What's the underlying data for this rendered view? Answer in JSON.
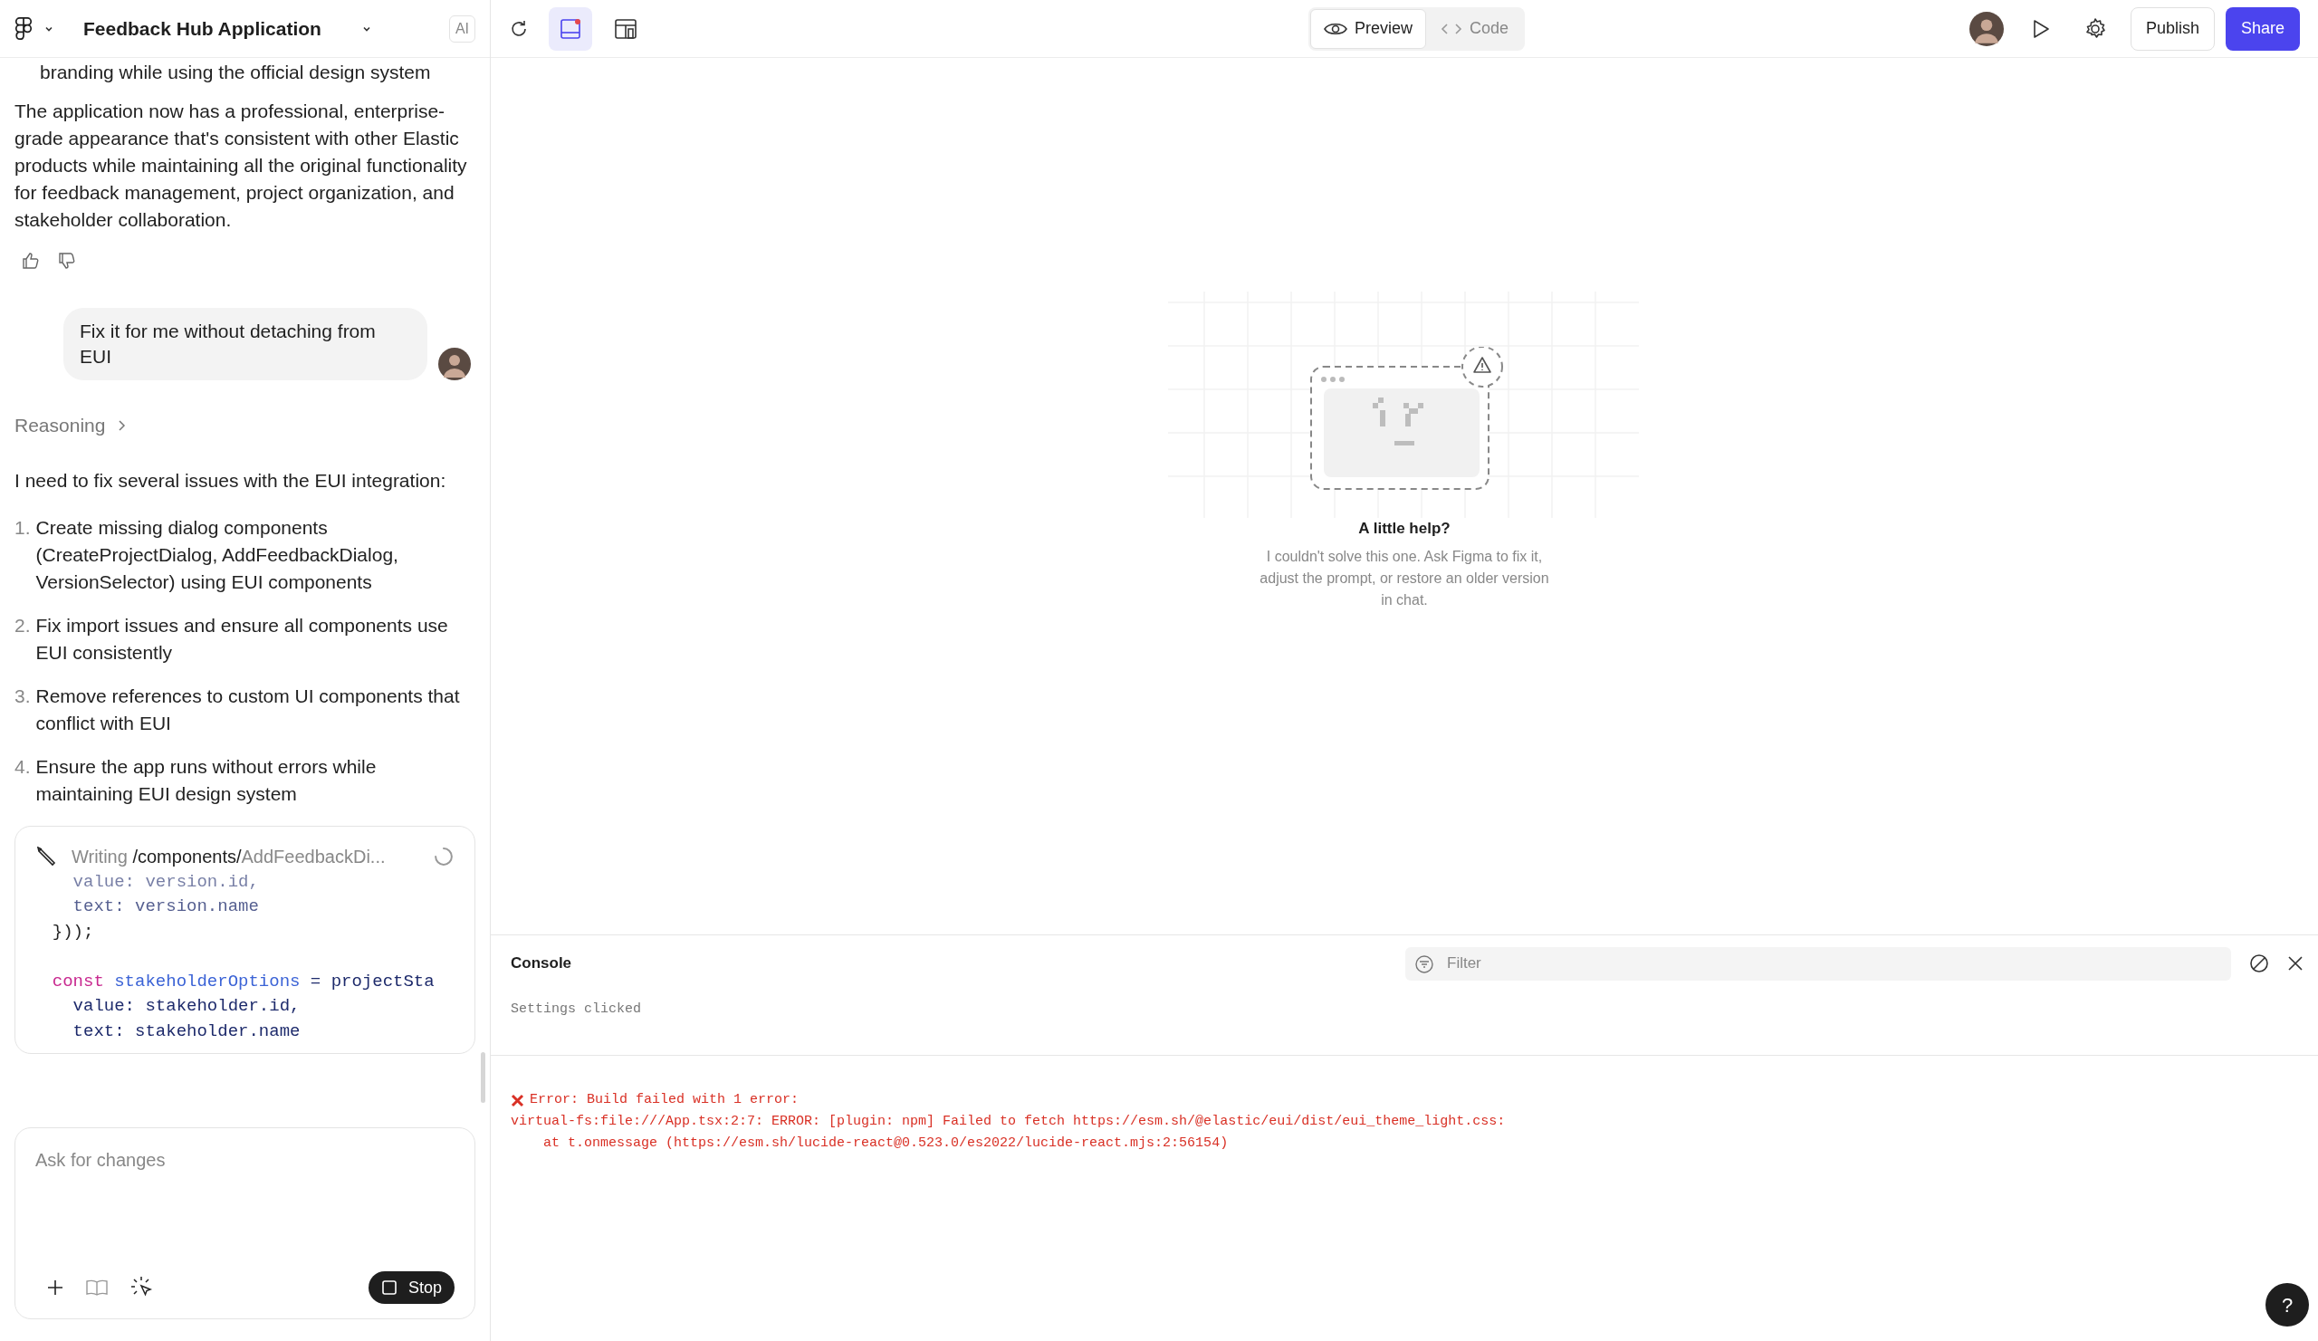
{
  "header": {
    "title": "Feedback Hub Application",
    "badge": "AI"
  },
  "chat": {
    "cut_text": "branding while using the official design system",
    "summary": "The application now has a professional, enterprise-grade appearance that's consistent with other Elastic products while maintaining all the original functionality for feedback management, project organization, and stakeholder collaboration.",
    "user_message": "Fix it for me without detaching from EUI",
    "reasoning_label": "Reasoning",
    "intro": "I need to fix several issues with the EUI integration:",
    "steps": [
      {
        "number": "1.",
        "text": "Create missing dialog components (CreateProjectDialog, AddFeedbackDialog, VersionSelector) using EUI components"
      },
      {
        "number": "2.",
        "text": "Fix import issues and ensure all components use EUI consistently"
      },
      {
        "number": "3.",
        "text": "Remove references to custom UI components that conflict with EUI"
      },
      {
        "number": "4.",
        "text": "Ensure the app runs without errors while maintaining EUI design system"
      }
    ],
    "writing": {
      "verb": "Writing",
      "folder": "/components/",
      "file": "AddFeedbackDi...",
      "code": [
        {
          "kind": "faded",
          "tokens": [
            {
              "kind": "plain",
              "text": "    value: version.id,"
            }
          ]
        },
        {
          "kind": "dim",
          "tokens": [
            {
              "kind": "plain",
              "text": "    text: version.name"
            }
          ]
        },
        {
          "kind": "normal",
          "tokens": [
            {
              "kind": "punct",
              "text": "  }));"
            }
          ]
        },
        {
          "kind": "blank"
        },
        {
          "kind": "normal",
          "tokens": [
            {
              "kind": "keyword",
              "text": "  const "
            },
            {
              "kind": "name",
              "text": "stakeholderOptions"
            },
            {
              "kind": "plain",
              "text": " = projectSta"
            }
          ]
        },
        {
          "kind": "normal",
          "tokens": [
            {
              "kind": "plain",
              "text": "    value: stakeholder.id,"
            }
          ]
        },
        {
          "kind": "normal",
          "tokens": [
            {
              "kind": "plain",
              "text": "    text: stakeholder.name"
            }
          ]
        }
      ]
    }
  },
  "composer": {
    "placeholder": "Ask for changes",
    "stop_label": "Stop"
  },
  "toolbar": {
    "view_tabs": [
      {
        "label": "Preview",
        "selected": true
      },
      {
        "label": "Code",
        "selected": false
      }
    ],
    "publish": "Publish",
    "share": "Share"
  },
  "preview": {
    "title": "A little help?",
    "message": "I couldn't solve this one. Ask Figma to fix it, adjust the prompt, or restore an older version in chat."
  },
  "console": {
    "title": "Console",
    "filter_placeholder": "Filter",
    "logs": [
      {
        "kind": "log",
        "lines": [
          "Settings clicked"
        ]
      },
      {
        "kind": "error",
        "lines": [
          "Error: Build failed with 1 error:",
          "virtual-fs:file:///App.tsx:2:7: ERROR: [plugin: npm] Failed to fetch https://esm.sh/@elastic/eui/dist/eui_theme_light.css:",
          "    at t.onmessage (https://esm.sh/lucide-react@0.523.0/es2022/lucide-react.mjs:2:56154)"
        ]
      }
    ]
  },
  "help_label": "?"
}
